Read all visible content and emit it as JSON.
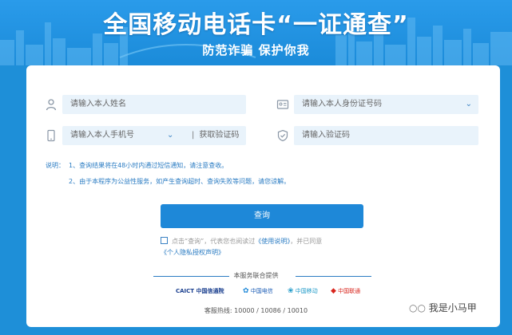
{
  "banner": {
    "title": "全国移动电话卡“一证通查”",
    "subtitle": "防范诈骗 保护你我"
  },
  "form": {
    "name_placeholder": "请输入本人姓名",
    "id_placeholder": "请输入本人身份证号码",
    "phone_placeholder": "请输入本人手机号",
    "get_code_label": "获取验证码",
    "code_placeholder": "请输入验证码"
  },
  "notes": {
    "label": "说明：",
    "line1": "1、查询结果将在48小时内通过短信通知，请注意查收。",
    "line2": "2、由于本程序为公益性服务，如产生查询超时、查询失败等问题，请您谅解。"
  },
  "query_button": "查询",
  "agreement": {
    "prefix": "点击“查询”，代表您也阅读过",
    "usage_link": "《使用说明》",
    "middle": "，并已同意",
    "privacy_link": "《个人隐私授权声明》"
  },
  "footer": {
    "coop": "本服务联合提供",
    "logos": [
      "CAICT 中国信通院",
      "中国电信",
      "中国移动",
      "中国联通"
    ],
    "hotline": "客服热线: 10000 / 10086 / 10010"
  },
  "watermark": "我是小马甲",
  "colors": {
    "brand": "#1e88d8",
    "field_bg": "#e9f3fb",
    "link": "#2b7cc3"
  }
}
